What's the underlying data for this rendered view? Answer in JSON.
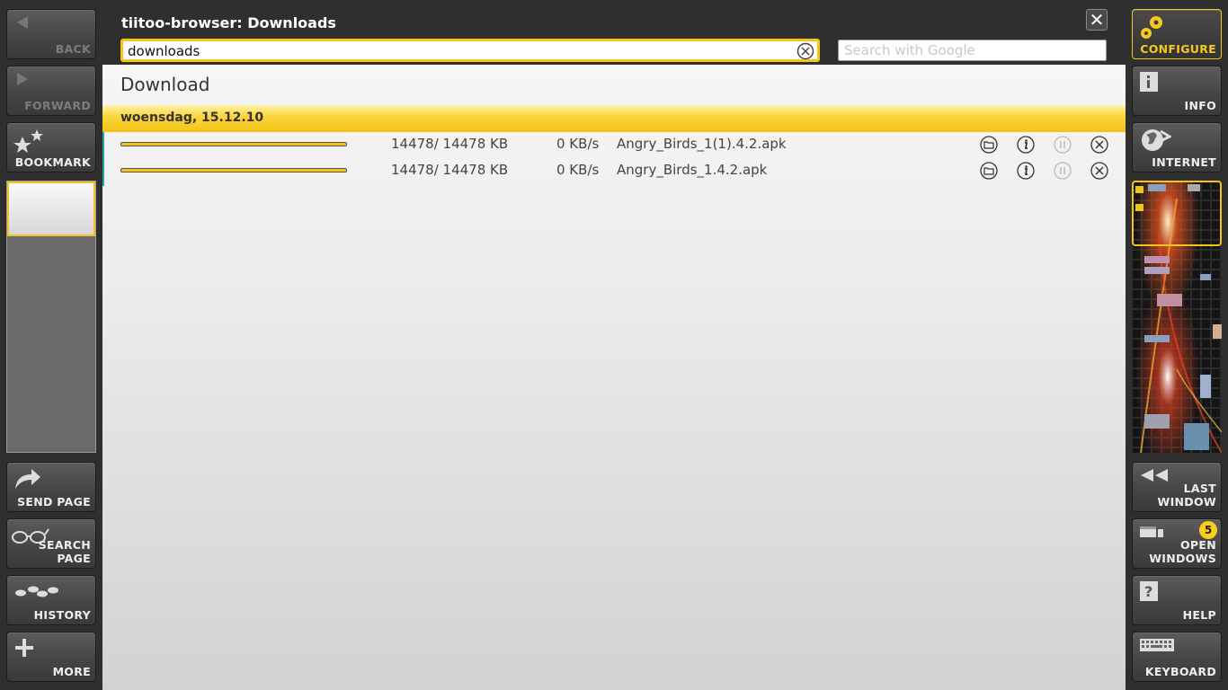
{
  "window": {
    "title": "tiitoo-browser: Downloads",
    "url_value": "downloads",
    "search_placeholder": "Search with Google"
  },
  "left_nav": {
    "back": "BACK",
    "forward": "FORWARD",
    "bookmark": "BOOKMARK",
    "send_page": "SEND PAGE",
    "search_page": "SEARCH PAGE",
    "history": "HISTORY",
    "more": "MORE"
  },
  "right_nav": {
    "configure": "CONFIGURE",
    "info": "INFO",
    "internet": "INTERNET",
    "last_window_1": "LAST",
    "last_window_2": "WINDOW",
    "open_windows_1": "OPEN",
    "open_windows_2": "WINDOWS",
    "open_windows_count": "5",
    "help": "HELP",
    "keyboard": "KEYBOARD"
  },
  "page": {
    "heading": "Download",
    "date_group": "woensdag, 15.12.10",
    "downloads": [
      {
        "size": "14478/  14478 KB",
        "speed": "0 KB/s",
        "filename": "Angry_Birds_1(1).4.2.apk",
        "progress": 1.0
      },
      {
        "size": "14478/  14478 KB",
        "speed": "0 KB/s",
        "filename": "Angry_Birds_1.4.2.apk",
        "progress": 1.0
      }
    ]
  },
  "colors": {
    "accent": "#f5c518",
    "background": "#2f2f2f"
  }
}
